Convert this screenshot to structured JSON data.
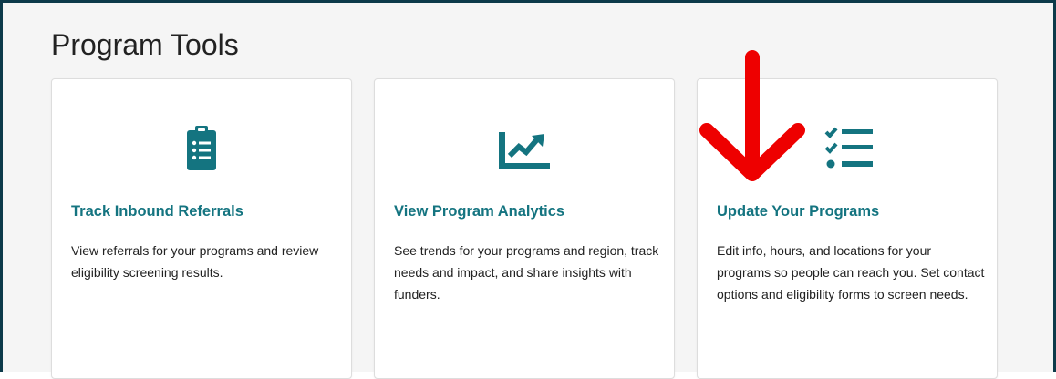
{
  "page": {
    "title": "Program Tools"
  },
  "colors": {
    "accent": "#147480",
    "annotation_arrow": "#ee0000",
    "frame_border": "#0d3a4a"
  },
  "cards": [
    {
      "icon": "clipboard-list-icon",
      "title": "Track Inbound Referrals",
      "description": "View referrals for your programs and review eligibility screening results."
    },
    {
      "icon": "chart-line-icon",
      "title": "View Program Analytics",
      "description": "See trends for your programs and region, track needs and impact, and share insights with funders."
    },
    {
      "icon": "checklist-icon",
      "title": "Update Your Programs",
      "description": "Edit info, hours, and locations for your programs so people can reach you. Set contact options and eligibility forms to screen needs."
    }
  ]
}
